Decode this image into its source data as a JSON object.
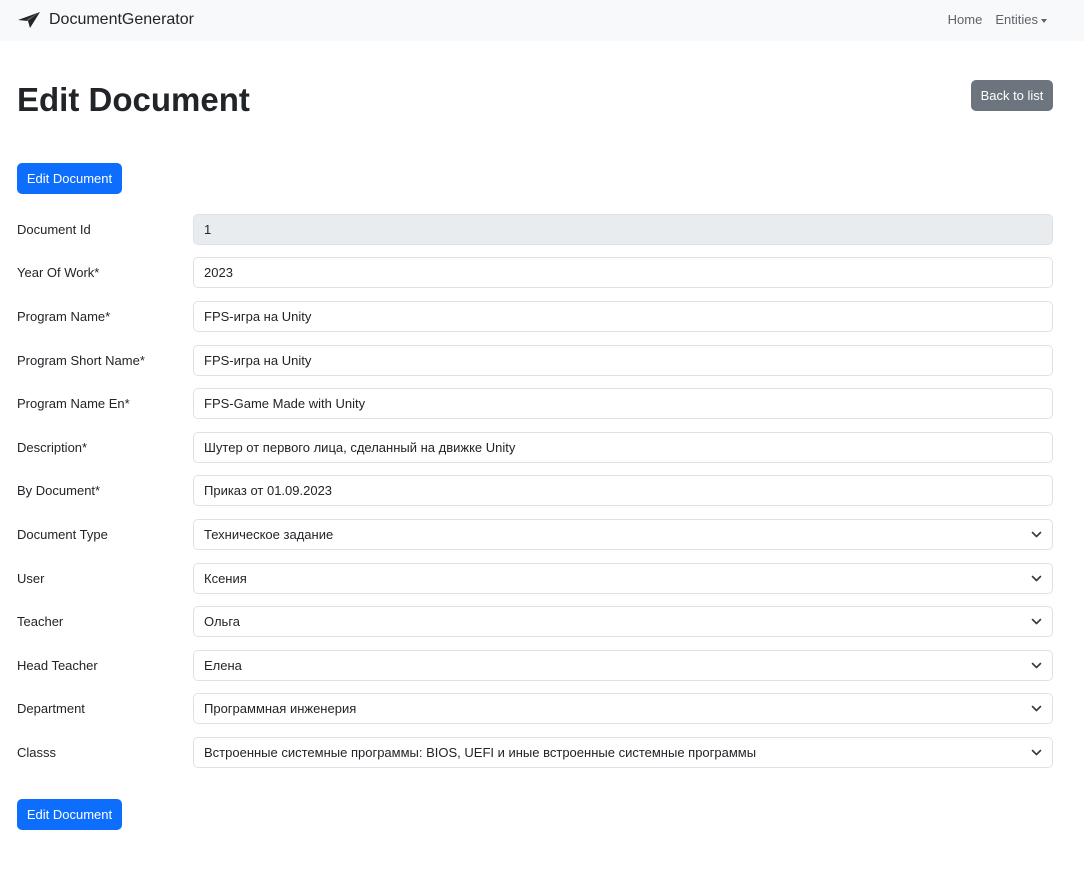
{
  "navbar": {
    "brand": "DocumentGenerator",
    "brand_icon": "paper-plane-icon",
    "links": [
      "Home",
      "Entities"
    ]
  },
  "page": {
    "title": "Edit Document",
    "back_label": "Back to list",
    "submit_label": "Edit Document"
  },
  "form": {
    "fields": [
      {
        "label": "Document Id",
        "value": "1",
        "type": "readonly"
      },
      {
        "label": "Year Of Work*",
        "value": "2023",
        "type": "input"
      },
      {
        "label": "Program Name*",
        "value": "FPS-игра на Unity",
        "type": "input"
      },
      {
        "label": "Program Short Name*",
        "value": "FPS-игра на Unity",
        "type": "input"
      },
      {
        "label": "Program Name En*",
        "value": "FPS-Game Made with Unity",
        "type": "input"
      },
      {
        "label": "Description*",
        "value": "Шутер от первого лица, сделанный на движке Unity",
        "type": "input"
      },
      {
        "label": "By Document*",
        "value": "Приказ от 01.09.2023",
        "type": "input"
      },
      {
        "label": "Document Type",
        "value": "Техническое задание",
        "type": "select"
      },
      {
        "label": "User",
        "value": "Ксения",
        "type": "select"
      },
      {
        "label": "Teacher",
        "value": "Ольга",
        "type": "select"
      },
      {
        "label": "Head Teacher",
        "value": "Елена",
        "type": "select"
      },
      {
        "label": "Department",
        "value": "Программная инженерия",
        "type": "select"
      },
      {
        "label": "Classs",
        "value": "Встроенные системные программы: BIOS, UEFI и иные встроенные системные программы",
        "type": "select"
      }
    ]
  },
  "colors": {
    "primary": "#0d6efd",
    "secondary": "#6c757d",
    "navbar_bg": "#f8f9fa",
    "readonly_bg": "#e9ecef"
  }
}
